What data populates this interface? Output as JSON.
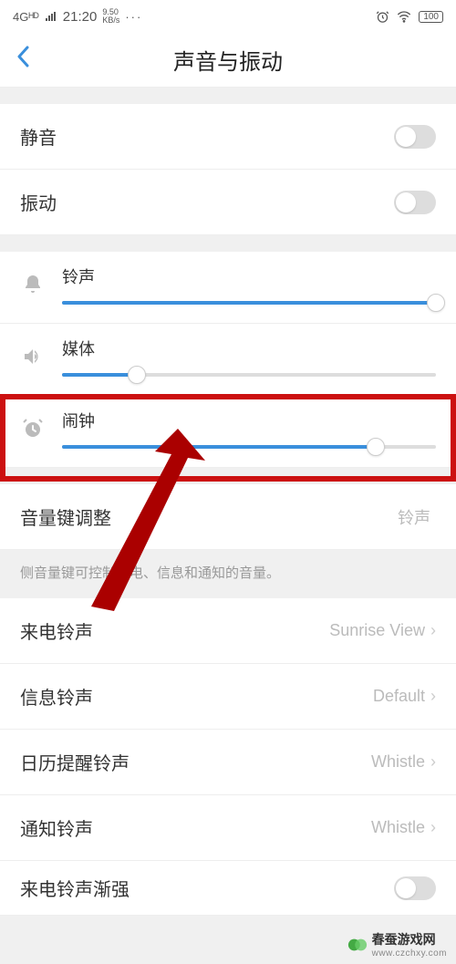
{
  "status": {
    "network": "4Gᴴᴰ",
    "time": "21:20",
    "speed_top": "9.50",
    "speed_bottom": "KB/s",
    "dots": "···",
    "battery": "100"
  },
  "nav": {
    "title": "声音与振动"
  },
  "toggles": {
    "mute": {
      "label": "静音"
    },
    "vibrate": {
      "label": "振动"
    }
  },
  "sliders": {
    "ring": {
      "label": "铃声",
      "percent": 100
    },
    "media": {
      "label": "媒体",
      "percent": 20
    },
    "alarm": {
      "label": "闹钟",
      "percent": 84
    }
  },
  "volume_key": {
    "label": "音量键调整",
    "value": "铃声",
    "desc": "侧音量键可控制来电、信息和通知的音量。"
  },
  "ringtones": {
    "incoming": {
      "label": "来电铃声",
      "value": "Sunrise View"
    },
    "message": {
      "label": "信息铃声",
      "value": "Default"
    },
    "calendar": {
      "label": "日历提醒铃声",
      "value": "Whistle"
    },
    "notification": {
      "label": "通知铃声",
      "value": "Whistle"
    }
  },
  "crescendo": {
    "label": "来电铃声渐强"
  },
  "watermark": {
    "name": "春蚕游戏网",
    "url": "www.czchxy.com"
  }
}
